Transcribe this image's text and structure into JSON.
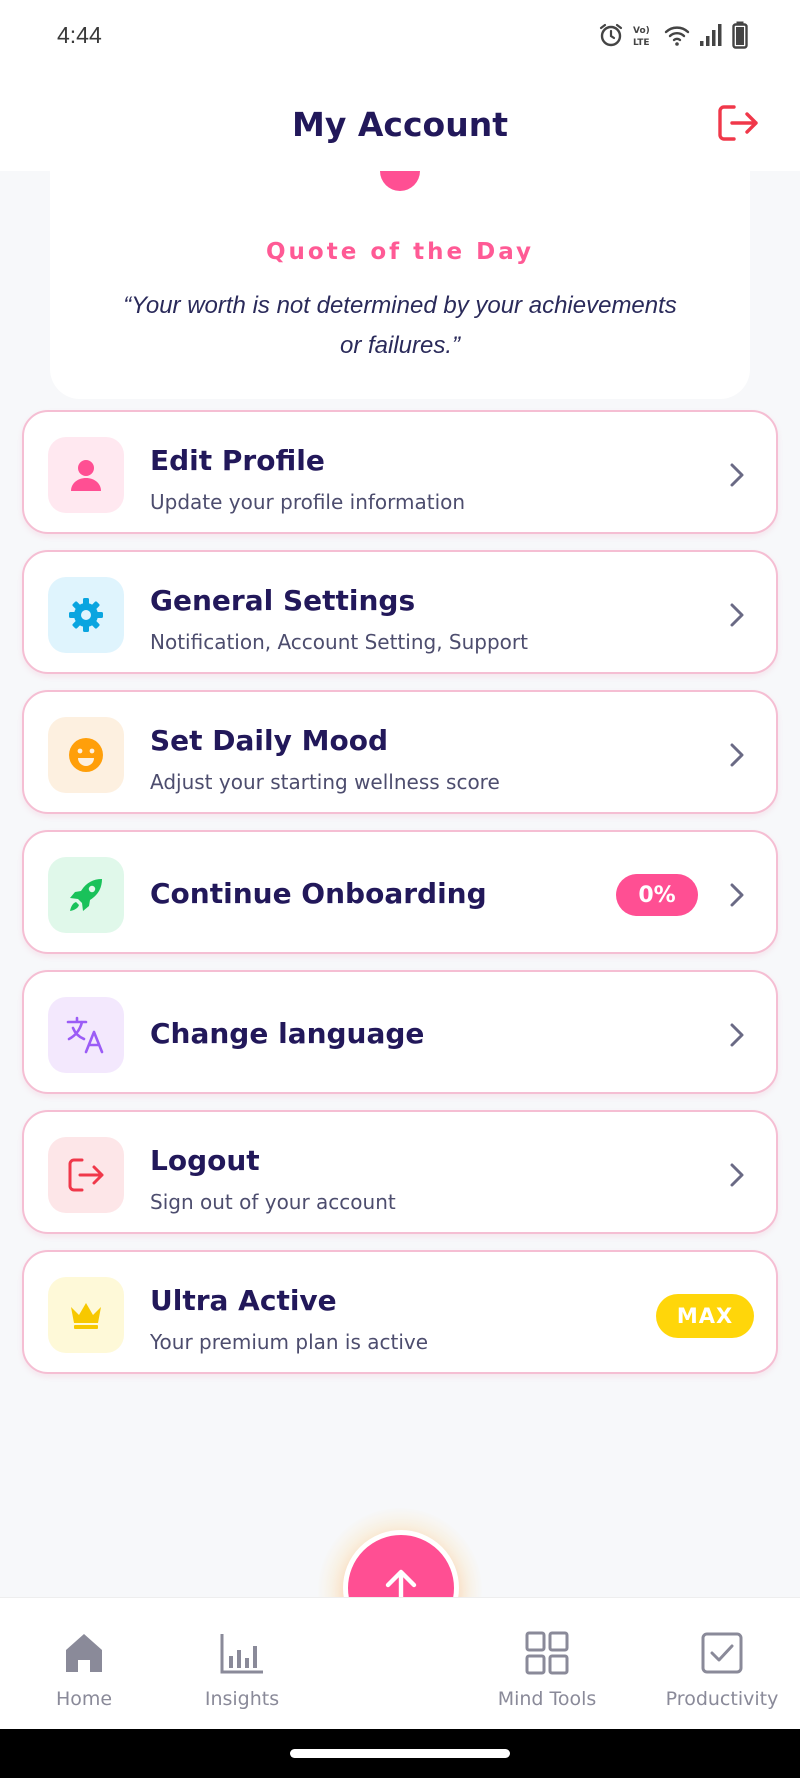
{
  "status_bar": {
    "time": "4:44"
  },
  "header": {
    "title": "My Account"
  },
  "quote": {
    "heading": "Quote of the Day",
    "text": "“Your worth is not determined by your achievements or failures.”"
  },
  "menu": [
    {
      "title": "Edit Profile",
      "subtitle": "Update your profile information",
      "icon": "person-icon",
      "icon_color": "#ff4f93",
      "tile_color": "#ffe8f0"
    },
    {
      "title": "General Settings",
      "subtitle": "Notification, Account Setting, Support",
      "icon": "gear-icon",
      "icon_color": "#0aa5e0",
      "tile_color": "#dff4fd"
    },
    {
      "title": "Set Daily Mood",
      "subtitle": "Adjust your starting wellness score",
      "icon": "smiley-icon",
      "icon_color": "#ff9f0a",
      "tile_color": "#fdf0e0"
    },
    {
      "title": "Continue Onboarding",
      "badge": "0%",
      "icon": "rocket-icon",
      "icon_color": "#19c25a",
      "tile_color": "#e0f8ea"
    },
    {
      "title": "Change language",
      "icon": "translate-icon",
      "icon_color": "#9b5cf6",
      "tile_color": "#f3e8fd"
    },
    {
      "title": "Logout",
      "subtitle": "Sign out of your account",
      "icon": "logout-icon",
      "icon_color": "#f0384a",
      "tile_color": "#fde6e8"
    },
    {
      "title": "Ultra Active",
      "subtitle": "Your premium plan is active",
      "badge": "MAX",
      "icon": "crown-icon",
      "icon_color": "#f7c800",
      "tile_color": "#fef9d8"
    }
  ],
  "bottom_nav": {
    "items": [
      {
        "label": "Home",
        "icon": "home-icon"
      },
      {
        "label": "Insights",
        "icon": "bar-chart-icon"
      },
      {
        "label": "Mind Tools",
        "icon": "grid-icon"
      },
      {
        "label": "Productivity",
        "icon": "checkbox-icon"
      }
    ],
    "fab_icon": "arrow-up-icon"
  },
  "colors": {
    "accent": "#ff4f93",
    "title": "#22185a",
    "card_border": "#f5bed3",
    "max_badge": "#ffd60a"
  }
}
